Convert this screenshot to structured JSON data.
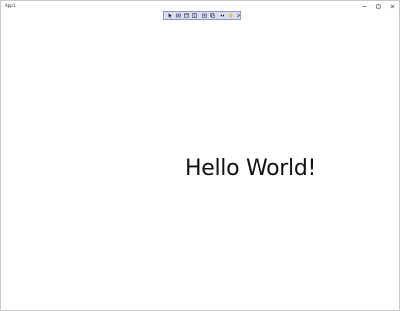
{
  "window": {
    "title": "App1",
    "controls": [
      "minimize-icon",
      "maximize-icon",
      "close-icon"
    ]
  },
  "toolbar": {
    "colors": {
      "background": "#d7dcf3",
      "border": "#8f98c6",
      "accent": "#3b5bdb"
    },
    "tools": [
      "select-element-icon",
      "display-layout-adorners-icon",
      "track-focused-element-icon",
      "display-layout-bounds-icon",
      "show-binding-failures-icon",
      "show-rendering-icon",
      "hot-reload-icon",
      "status-icon",
      "collapse-icon"
    ]
  },
  "main": {
    "greeting": "Hello World!"
  }
}
